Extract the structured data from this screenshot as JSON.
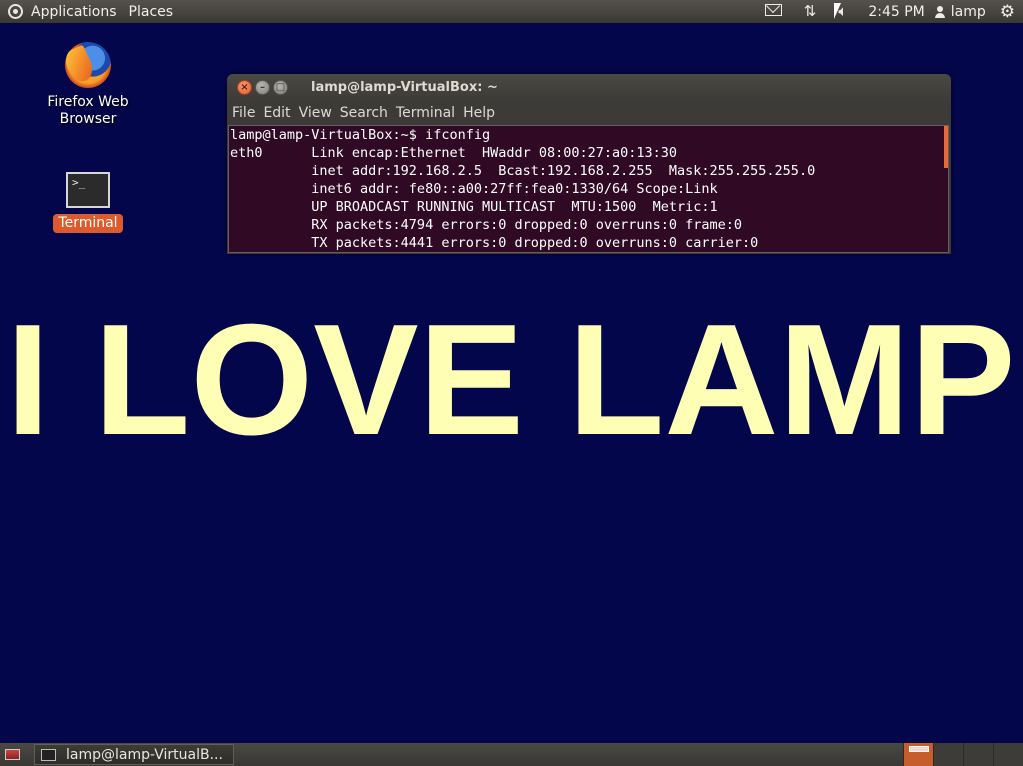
{
  "top_panel": {
    "menus": [
      "Applications",
      "Places"
    ],
    "clock": "2:45 PM",
    "user": "lamp",
    "icons": [
      "mail-icon",
      "network-icon",
      "volume-icon",
      "gear-icon"
    ]
  },
  "desktop": {
    "firefox_label_line1": "Firefox Web",
    "firefox_label_line2": "Browser",
    "terminal_label": "Terminal"
  },
  "terminal": {
    "title": "lamp@lamp-VirtualBox: ~",
    "menu": [
      "File",
      "Edit",
      "View",
      "Search",
      "Terminal",
      "Help"
    ],
    "lines": [
      "lamp@lamp-VirtualBox:~$ ifconfig",
      "eth0      Link encap:Ethernet  HWaddr 08:00:27:a0:13:30",
      "          inet addr:192.168.2.5  Bcast:192.168.2.255  Mask:255.255.255.0",
      "          inet6 addr: fe80::a00:27ff:fea0:1330/64 Scope:Link",
      "          UP BROADCAST RUNNING MULTICAST  MTU:1500  Metric:1",
      "          RX packets:4794 errors:0 dropped:0 overruns:0 frame:0",
      "          TX packets:4441 errors:0 dropped:0 overruns:0 carrier:0"
    ]
  },
  "banner": "I LOVE LAMP",
  "bottom_panel": {
    "task_label": "lamp@lamp-VirtualB..."
  },
  "colors": {
    "desktop_bg": "#03064a",
    "banner_text": "#fefeb4",
    "terminal_bg": "#300a24",
    "accent": "#dd5a2c"
  }
}
